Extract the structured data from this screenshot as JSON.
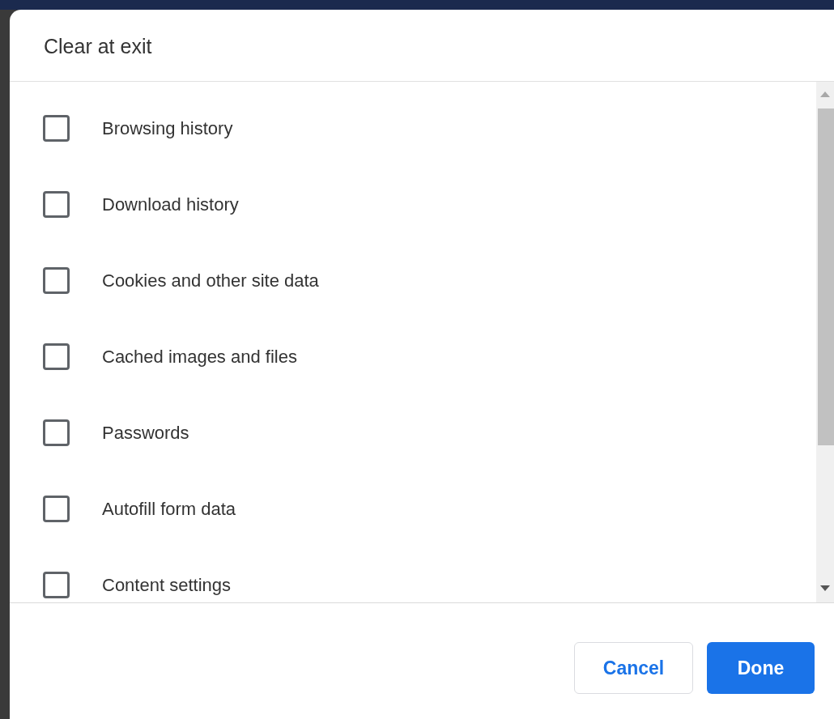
{
  "dialog": {
    "title": "Clear at exit"
  },
  "items": [
    {
      "label": "Browsing history",
      "checked": false
    },
    {
      "label": "Download history",
      "checked": false
    },
    {
      "label": "Cookies and other site data",
      "checked": false
    },
    {
      "label": "Cached images and files",
      "checked": false
    },
    {
      "label": "Passwords",
      "checked": false
    },
    {
      "label": "Autofill form data",
      "checked": false
    },
    {
      "label": "Content settings",
      "checked": false
    }
  ],
  "buttons": [
    {
      "label": "Cancel",
      "kind": "secondary"
    },
    {
      "label": "Done",
      "kind": "primary"
    }
  ]
}
